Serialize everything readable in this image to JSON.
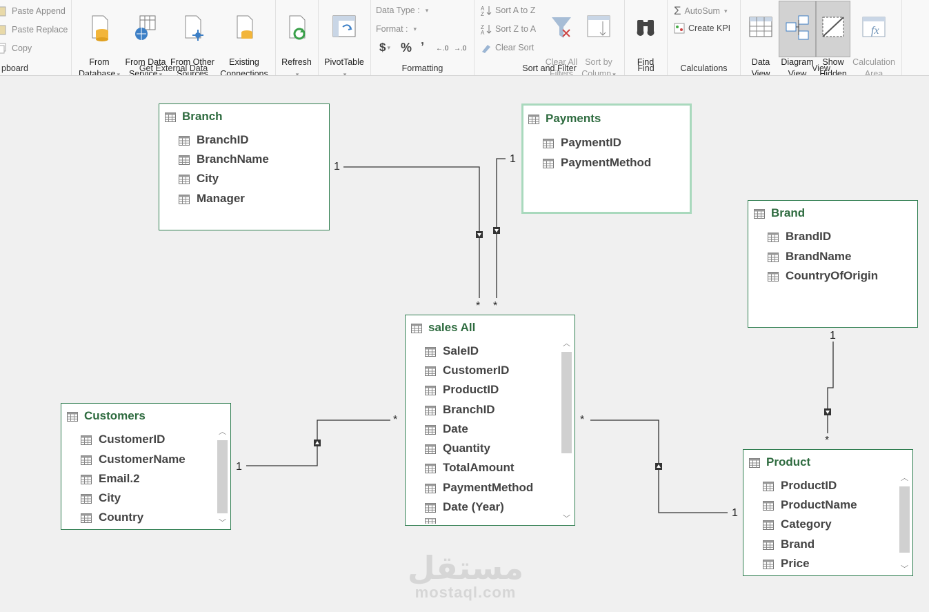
{
  "ribbon": {
    "clipboard": {
      "label": "pboard",
      "paste_append": "Paste Append",
      "paste_replace": "Paste Replace",
      "copy": "Copy"
    },
    "external": {
      "label": "Get External Data",
      "from_database": "From\nDatabase",
      "from_data_service": "From Data\nService",
      "from_other_sources": "From Other\nSources",
      "existing_connections": "Existing\nConnections"
    },
    "refresh": "Refresh",
    "pivottable": "PivotTable",
    "formatting": {
      "label": "Formatting",
      "data_type": "Data Type :",
      "format": "Format :",
      "currency": "$",
      "percent": "%",
      "comma": "ʼ"
    },
    "sort_filter": {
      "label": "Sort and Filter",
      "sort_az": "Sort A to Z",
      "sort_za": "Sort Z to A",
      "clear_sort": "Clear Sort",
      "clear_all_filters": "Clear All\nFilters",
      "sort_by_column": "Sort by\nColumn"
    },
    "find": {
      "label": "Find",
      "button": "Find"
    },
    "calculations": {
      "label": "Calculations",
      "autosum": "AutoSum",
      "create_kpi": "Create KPI"
    },
    "view": {
      "label": "View",
      "data_view": "Data\nView",
      "diagram_view": "Diagram\nView",
      "show_hidden": "Show\nHidden",
      "calculation_area": "Calculation\nArea"
    }
  },
  "tables": {
    "branch": {
      "title": "Branch",
      "columns": [
        "BranchID",
        "BranchName",
        "City",
        "Manager"
      ]
    },
    "payments": {
      "title": "Payments",
      "columns": [
        "PaymentID",
        "PaymentMethod"
      ]
    },
    "brand": {
      "title": "Brand",
      "columns": [
        "BrandID",
        "BrandName",
        "CountryOfOrigin"
      ]
    },
    "sales": {
      "title": "sales All",
      "columns": [
        "SaleID",
        "CustomerID",
        "ProductID",
        "BranchID",
        "Date",
        "Quantity",
        "TotalAmount",
        "PaymentMethod",
        "Date (Year)"
      ]
    },
    "customers": {
      "title": "Customers",
      "columns": [
        "CustomerID",
        "CustomerName",
        "Email.2",
        "City",
        "Country"
      ]
    },
    "product": {
      "title": "Product",
      "columns": [
        "ProductID",
        "ProductName",
        "Category",
        "Brand",
        "Price"
      ]
    }
  },
  "relationships": {
    "one": "1",
    "many": "*"
  },
  "watermark": {
    "arabic": "مستقل",
    "latin": "mostaql.com"
  },
  "colors": {
    "table_title": "#2e6b3f",
    "table_border": "#2e7d4f",
    "selected_border": "#a9d9bd"
  }
}
